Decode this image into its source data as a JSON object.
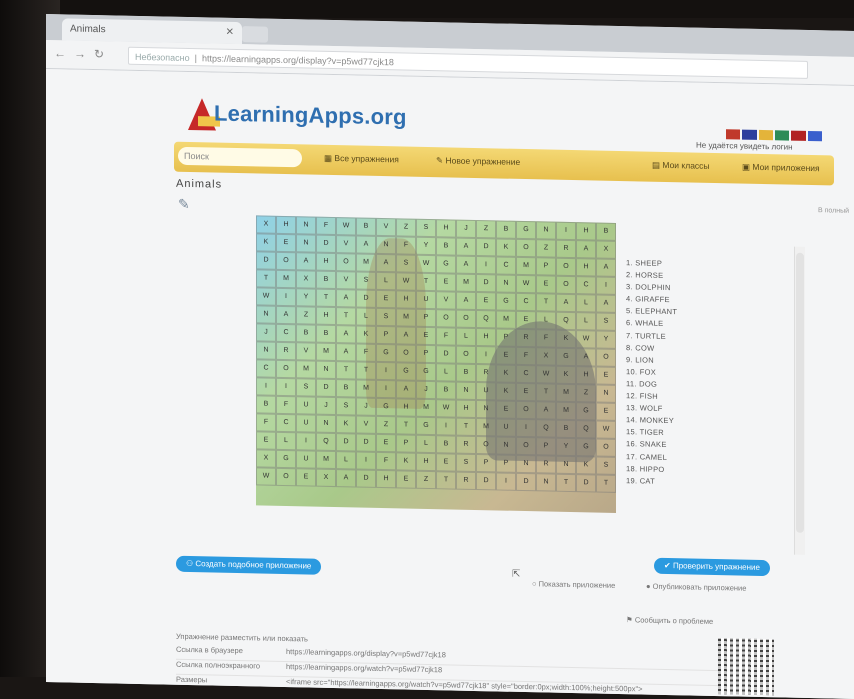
{
  "browser": {
    "tab_title": "Animals",
    "url_scheme": "Небезопасно",
    "url": "https://learningapps.org/display?v=p5wd77cjk18"
  },
  "header": {
    "logo_text": "LearningApps.org",
    "search_placeholder": "Поиск",
    "all_exercises": "Все упражнения",
    "new_exercise": "Новое упражнение",
    "my_classes": "Мои классы",
    "my_apps": "Мои приложения",
    "login_text": "Не удаётся увидеть логин"
  },
  "app": {
    "title": "Animals",
    "fullscreen": "В полный"
  },
  "grid": [
    [
      "X",
      "H",
      "N",
      "F",
      "W",
      "B",
      "V",
      "Z",
      "S",
      "H",
      "J",
      "Z",
      "B",
      "G",
      "N",
      "I",
      "H",
      "B",
      "",
      ""
    ],
    [
      "K",
      "E",
      "N",
      "D",
      "V",
      "A",
      "N",
      "F",
      "Y",
      "B",
      "A",
      "D",
      "K",
      "O",
      "Z",
      "R",
      "A",
      "X",
      "",
      ""
    ],
    [
      "D",
      "O",
      "A",
      "H",
      "O",
      "M",
      "A",
      "S",
      "W",
      "G",
      "A",
      "I",
      "C",
      "M",
      "P",
      "O",
      "H",
      "A",
      "",
      ""
    ],
    [
      "T",
      "M",
      "X",
      "B",
      "V",
      "S",
      "L",
      "W",
      "T",
      "E",
      "M",
      "D",
      "N",
      "W",
      "E",
      "O",
      "C",
      "I",
      "",
      ""
    ],
    [
      "W",
      "I",
      "Y",
      "T",
      "A",
      "D",
      "E",
      "H",
      "U",
      "V",
      "A",
      "E",
      "G",
      "C",
      "T",
      "A",
      "L",
      "A",
      "",
      ""
    ],
    [
      "N",
      "A",
      "Z",
      "H",
      "T",
      "L",
      "S",
      "M",
      "P",
      "O",
      "O",
      "Q",
      "M",
      "E",
      "L",
      "Q",
      "L",
      "S",
      "",
      ""
    ],
    [
      "J",
      "C",
      "B",
      "B",
      "A",
      "K",
      "P",
      "A",
      "E",
      "F",
      "L",
      "H",
      "P",
      "R",
      "F",
      "K",
      "W",
      "Y",
      "",
      ""
    ],
    [
      "N",
      "R",
      "V",
      "M",
      "A",
      "F",
      "G",
      "O",
      "P",
      "D",
      "O",
      "I",
      "E",
      "F",
      "X",
      "G",
      "A",
      "O",
      "",
      ""
    ],
    [
      "C",
      "O",
      "M",
      "N",
      "T",
      "T",
      "I",
      "G",
      "G",
      "L",
      "B",
      "R",
      "K",
      "C",
      "W",
      "K",
      "H",
      "E",
      "",
      ""
    ],
    [
      "I",
      "I",
      "S",
      "D",
      "B",
      "M",
      "I",
      "A",
      "J",
      "B",
      "N",
      "U",
      "K",
      "E",
      "T",
      "M",
      "Z",
      "N",
      "",
      ""
    ],
    [
      "B",
      "F",
      "U",
      "J",
      "S",
      "J",
      "G",
      "H",
      "M",
      "W",
      "H",
      "N",
      "E",
      "O",
      "A",
      "M",
      "G",
      "E",
      "",
      ""
    ],
    [
      "F",
      "C",
      "U",
      "N",
      "K",
      "V",
      "Z",
      "T",
      "G",
      "I",
      "T",
      "M",
      "U",
      "I",
      "Q",
      "B",
      "Q",
      "W",
      "",
      ""
    ],
    [
      "E",
      "L",
      "I",
      "Q",
      "D",
      "D",
      "E",
      "P",
      "L",
      "B",
      "R",
      "O",
      "N",
      "O",
      "P",
      "Y",
      "G",
      "O",
      "",
      ""
    ],
    [
      "X",
      "G",
      "U",
      "M",
      "L",
      "I",
      "F",
      "K",
      "H",
      "E",
      "S",
      "P",
      "P",
      "N",
      "R",
      "N",
      "K",
      "S",
      "",
      ""
    ],
    [
      "W",
      "O",
      "E",
      "X",
      "A",
      "D",
      "H",
      "E",
      "Z",
      "T",
      "R",
      "D",
      "I",
      "D",
      "N",
      "T",
      "D",
      "T",
      "",
      ""
    ],
    [
      "",
      "",
      "",
      "",
      "",
      "",
      "",
      "",
      "",
      "",
      "",
      "",
      "",
      "",
      "",
      "",
      "",
      "",
      "",
      ""
    ]
  ],
  "word_list": [
    "1. SHEEP",
    "2. HORSE",
    "3. DOLPHIN",
    "4. GIRAFFE",
    "5. ELEPHANT",
    "6. WHALE",
    "7. TURTLE",
    "8. COW",
    "9. LION",
    "10. FOX",
    "11. DOG",
    "12. FISH",
    "13. WOLF",
    "14. MONKEY",
    "15. TIGER",
    "16. SNAKE",
    "17. CAMEL",
    "18. HIPPO",
    "19. CAT"
  ],
  "actions": {
    "create_similar": "Создать подобное приложение",
    "check_solution": "Проверить упражнение",
    "radio_1": "Показать приложение",
    "radio_2": "Опубликовать приложение",
    "feedback": "Сообщить о проблеме"
  },
  "share": {
    "heading": "Упражнение разместить или показать",
    "rows": [
      {
        "k": "Ссылка в браузере",
        "v": "https://learningapps.org/display?v=p5wd77cjk18"
      },
      {
        "k": "Ссылка полноэкранного",
        "v": "https://learningapps.org/watch?v=p5wd77cjk18"
      },
      {
        "k": "Размеры",
        "v": "<iframe src=\"https://learningapps.org/watch?v=p5wd77cjk18\" style=\"border:0px;width:100%;height:500px\">"
      }
    ]
  },
  "colors": {
    "accent_yellow": "#e7c04e",
    "logo_blue": "#2f6fb0",
    "button_blue": "#2b9ae0"
  }
}
